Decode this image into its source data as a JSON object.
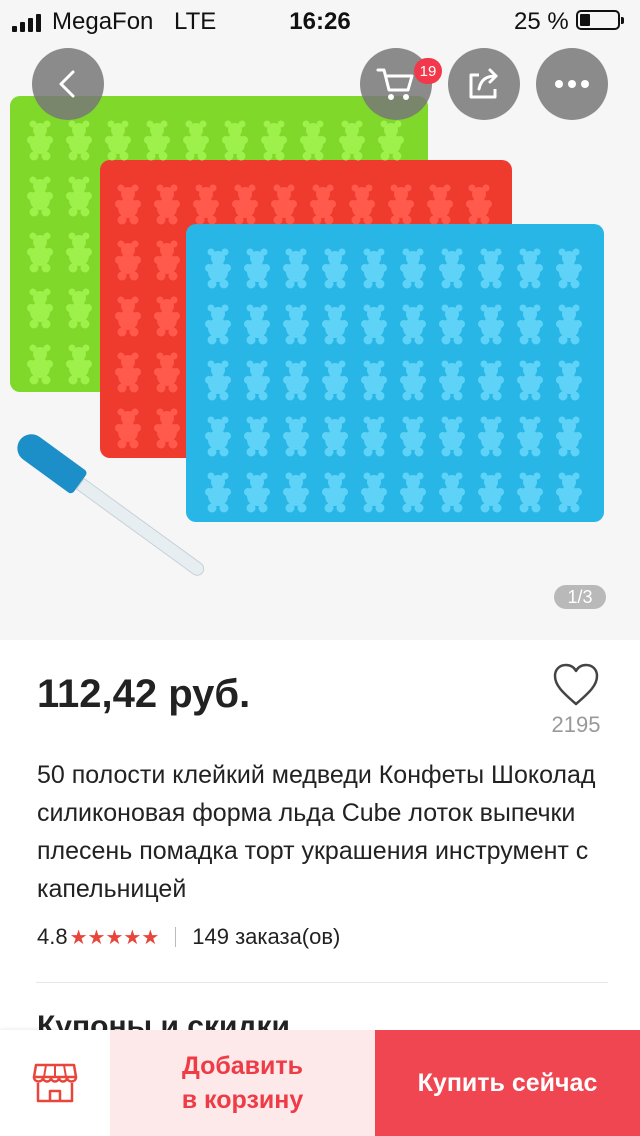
{
  "status_bar": {
    "carrier": "MegaFon",
    "network": "LTE",
    "time": "16:26",
    "battery": "25 %"
  },
  "gallery": {
    "pager": "1/3"
  },
  "header": {
    "cart_count": "19"
  },
  "product": {
    "price": "112,42 руб.",
    "wishlist_count": "2195",
    "title": "50 полости клейкий медведи Конфеты Шоколад силиконовая форма льда Cube лоток выпечки плесень помадка торт украшения инструмент с капельницей",
    "rating": "4.8",
    "stars": "★★★★★",
    "orders": "149 заказа(ов)"
  },
  "sections": {
    "coupons_heading": "Купоны и скидки"
  },
  "bottom_bar": {
    "add_to_cart_line1": "Добавить",
    "add_to_cart_line2": "в корзину",
    "buy_now": "Купить сейчас"
  },
  "colors": {
    "accent": "#f04651",
    "accent_light": "#fde9ea",
    "badge": "#f2394b",
    "star": "#e8463a"
  }
}
